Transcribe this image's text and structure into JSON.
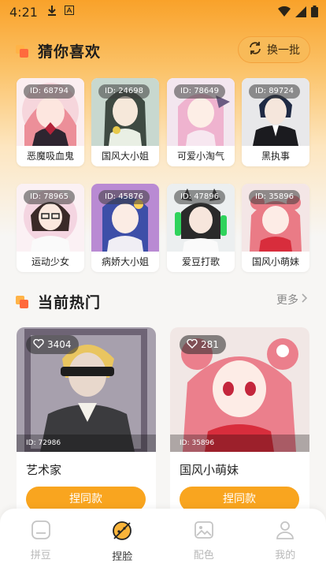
{
  "status_bar": {
    "time": "4:21"
  },
  "guess": {
    "title": "猜你喜欢",
    "swap_label": "换一批",
    "items": [
      {
        "id": "ID: 68794",
        "name": "恶魔吸血鬼"
      },
      {
        "id": "ID: 24698",
        "name": "国风大小姐"
      },
      {
        "id": "ID: 78649",
        "name": "可爱小淘气"
      },
      {
        "id": "ID: 89724",
        "name": "黑执事"
      },
      {
        "id": "ID: 78965",
        "name": "运动少女"
      },
      {
        "id": "ID: 45876",
        "name": "病娇大小姐"
      },
      {
        "id": "ID: 47896",
        "name": "爱豆打歌"
      },
      {
        "id": "ID: 35896",
        "name": "国风小萌妹"
      }
    ]
  },
  "hot": {
    "title": "当前热门",
    "more_label": "更多",
    "items": [
      {
        "likes": "3404",
        "id": "ID: 72986",
        "name": "艺术家",
        "button": "捏同款"
      },
      {
        "likes": "281",
        "id": "ID: 35896",
        "name": "国风小萌妹",
        "button": "捏同款"
      }
    ]
  },
  "tabbar": {
    "items": [
      {
        "label": "拼豆",
        "icon": "bean-icon",
        "active": false
      },
      {
        "label": "捏脸",
        "icon": "face-pinch-icon",
        "active": true
      },
      {
        "label": "配色",
        "icon": "image-icon",
        "active": false
      },
      {
        "label": "我的",
        "icon": "person-icon",
        "active": false
      }
    ]
  },
  "colors": {
    "accent": "#f9a51f",
    "accent_light": "#f8ba58",
    "icon_orange": "#ff6a3d"
  }
}
